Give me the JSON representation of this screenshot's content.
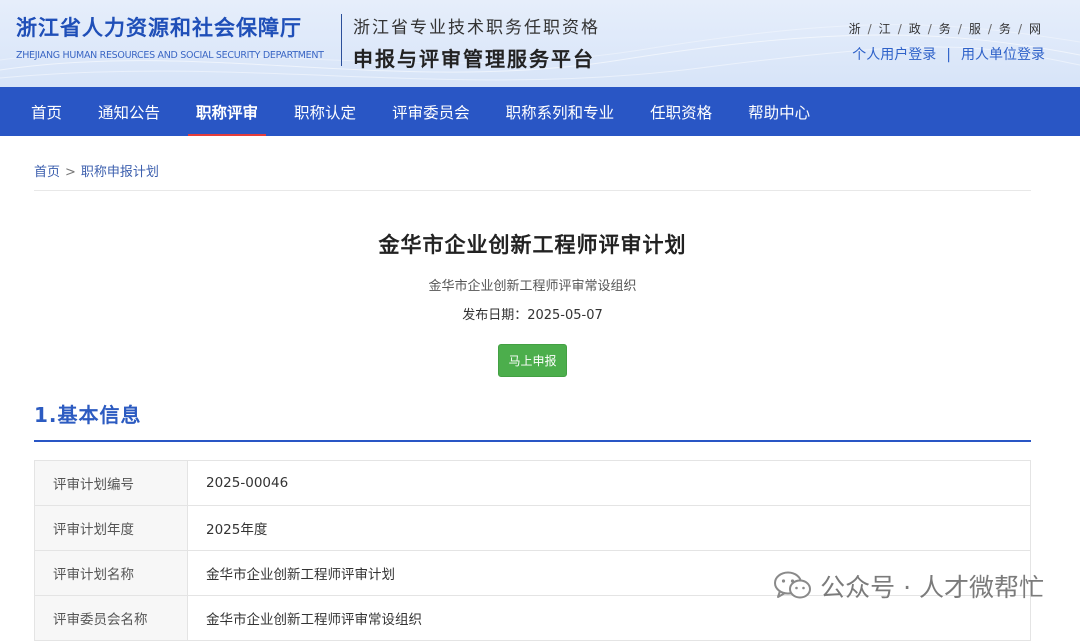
{
  "header": {
    "dept_name_cn": "浙江省人力资源和社会保障厅",
    "dept_name_en": "ZHEJIANG HUMAN RESOURCES AND SOCIAL SECURITY DEPARTMENT",
    "platform_line1": "浙江省专业技术职务任职资格",
    "platform_line2": "申报与评审管理服务平台",
    "gov_service_chars": [
      "浙",
      "江",
      "政",
      "务",
      "服",
      "务",
      "网"
    ],
    "personal_login": "个人用户登录",
    "separator": "|",
    "employer_login": "用人单位登录"
  },
  "nav": {
    "items": [
      {
        "label": "首页"
      },
      {
        "label": "通知公告"
      },
      {
        "label": "职称评审"
      },
      {
        "label": "职称认定"
      },
      {
        "label": "评审委员会"
      },
      {
        "label": "职称系列和专业"
      },
      {
        "label": "任职资格"
      },
      {
        "label": "帮助中心"
      }
    ],
    "active_index": 2
  },
  "breadcrumb": {
    "home": "首页",
    "separator": ">",
    "current": "职称申报计划"
  },
  "plan": {
    "title": "金华市企业创新工程师评审计划",
    "org": "金华市企业创新工程师评审常设组织",
    "pubdate": "发布日期：2025-05-07",
    "apply_button": "马上申报"
  },
  "section": {
    "title": "1.基本信息"
  },
  "info_table": {
    "rows": [
      {
        "key": "评审计划编号",
        "value": "2025-00046"
      },
      {
        "key": "评审计划年度",
        "value": "2025年度"
      },
      {
        "key": "评审计划名称",
        "value": "金华市企业创新工程师评审计划"
      },
      {
        "key": "评审委员会名称",
        "value": "金华市企业创新工程师评审常设组织"
      }
    ]
  },
  "watermark": {
    "text": "公众号 · 人才微帮忙",
    "icon": "wechat-icon"
  },
  "colors": {
    "nav_bg": "#2956c5",
    "brand_blue": "#1f4fb8",
    "active_underline": "#e33c3c",
    "button_green": "#4cae4c"
  }
}
